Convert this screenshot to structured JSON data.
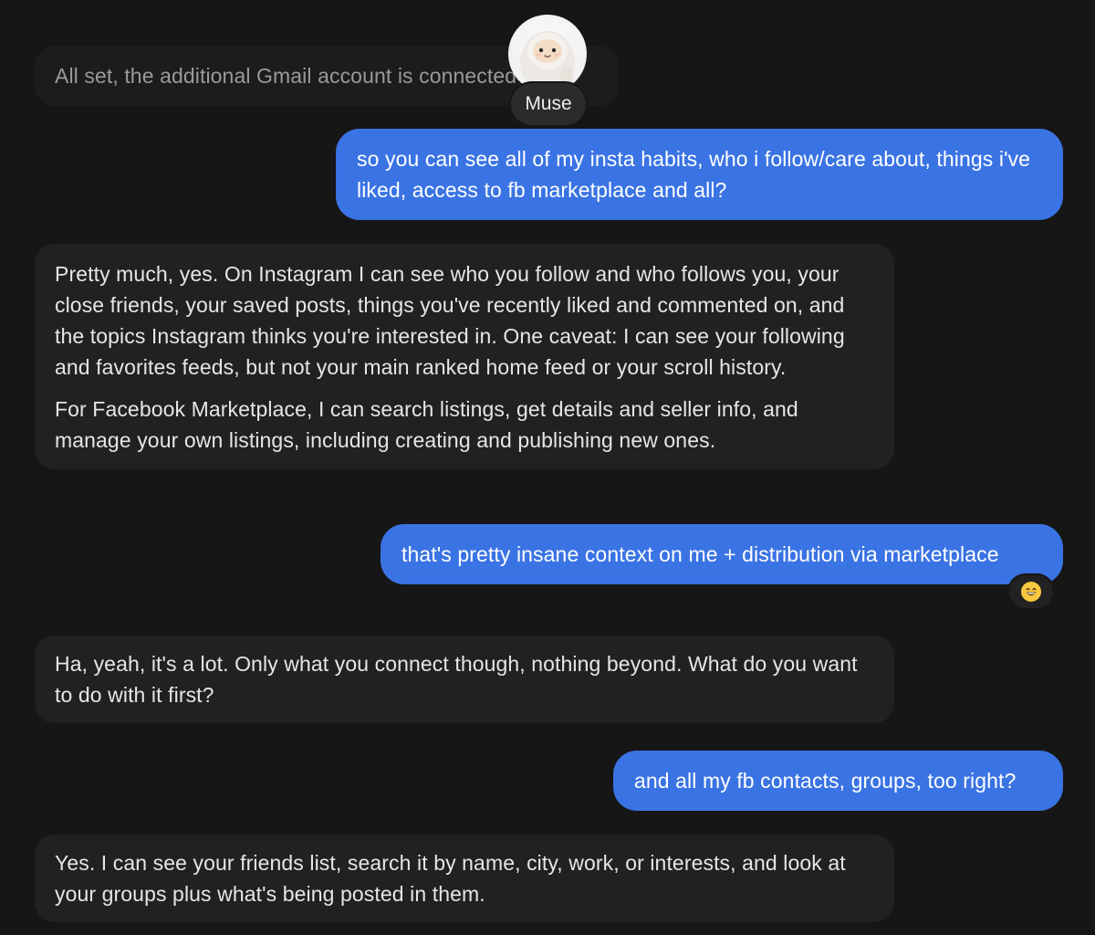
{
  "assistant": {
    "name": "Muse",
    "avatar_icon": "cute-mascot-avatar"
  },
  "messages": [
    {
      "role": "assistant",
      "paragraphs": [
        "All set, the additional Gmail account is connected too."
      ]
    },
    {
      "role": "user",
      "text": "so you can see all of my insta habits, who i follow/care about, things i've liked, access to fb marketplace and all?"
    },
    {
      "role": "assistant",
      "paragraphs": [
        "Pretty much, yes. On Instagram I can see who you follow and who follows you, your close friends, your saved posts, things you've recently liked and commented on, and the topics Instagram thinks you're interested in. One caveat: I can see your following and favorites feeds, but not your main ranked home feed or your scroll history.",
        "For Facebook Marketplace, I can search listings, get details and seller info, and manage your own listings, including creating and publishing new ones."
      ]
    },
    {
      "role": "user",
      "text": "that's pretty insane context on me + distribution via marketplace",
      "reaction": "😄"
    },
    {
      "role": "assistant",
      "paragraphs": [
        "Ha, yeah, it's a lot. Only what you connect though, nothing beyond. What do you want to do with it first?"
      ]
    },
    {
      "role": "user",
      "text": "and all my fb contacts, groups, too right?"
    },
    {
      "role": "assistant",
      "paragraphs": [
        "Yes. I can see your friends list, search it by name, city, work, or interests, and look at your groups plus what's being posted in them."
      ]
    }
  ],
  "colors": {
    "background": "#161616",
    "assistant_bubble": "#212121",
    "user_bubble": "#3a73e3",
    "text_primary": "#e6e6e6"
  }
}
